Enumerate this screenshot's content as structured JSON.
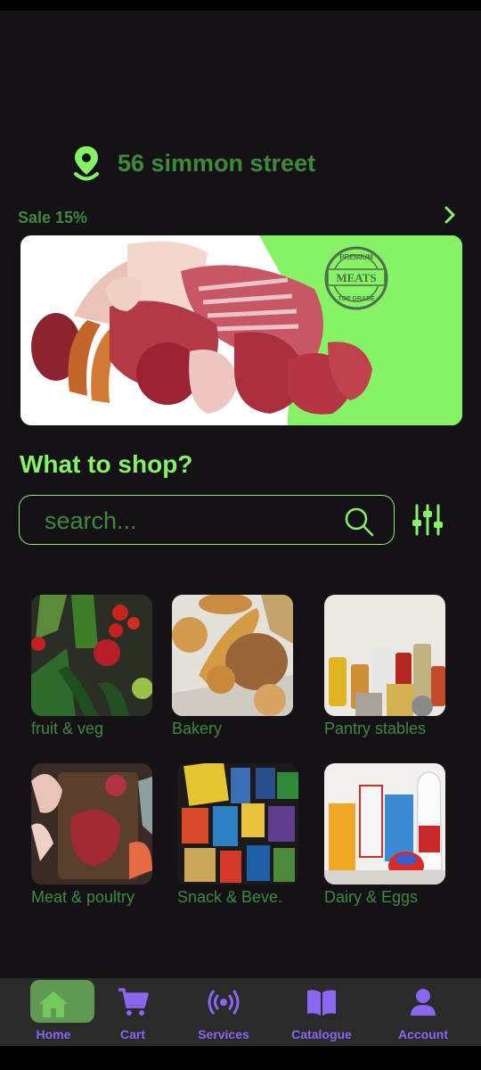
{
  "location": {
    "address": "56 simmon street",
    "icon": "location-pin-icon"
  },
  "promo": {
    "label": "Sale 15%",
    "banner_stamp": [
      "PREMIUM",
      "MEATS",
      "TOP GRADE"
    ],
    "accent": "#86f266"
  },
  "section": {
    "title": "What to shop?"
  },
  "search": {
    "placeholder": "search...",
    "value": ""
  },
  "categories": [
    {
      "label": "fruit & veg"
    },
    {
      "label": "Bakery"
    },
    {
      "label": "Pantry stables"
    },
    {
      "label": "Meat & poultry"
    },
    {
      "label": "Snack & Beve."
    },
    {
      "label": "Dairy & Eggs"
    }
  ],
  "nav": {
    "items": [
      {
        "label": "Home",
        "icon": "home-icon",
        "active": true
      },
      {
        "label": "Cart",
        "icon": "cart-icon"
      },
      {
        "label": "Services",
        "icon": "broadcast-icon"
      },
      {
        "label": "Catalogue",
        "icon": "book-icon"
      },
      {
        "label": "Account",
        "icon": "person-icon"
      }
    ]
  },
  "colors": {
    "background": "#141216",
    "green": "#86f266",
    "dark_green": "#3f8a3a",
    "purple": "#8b66f2",
    "nav_bg": "#2a2b2a"
  }
}
